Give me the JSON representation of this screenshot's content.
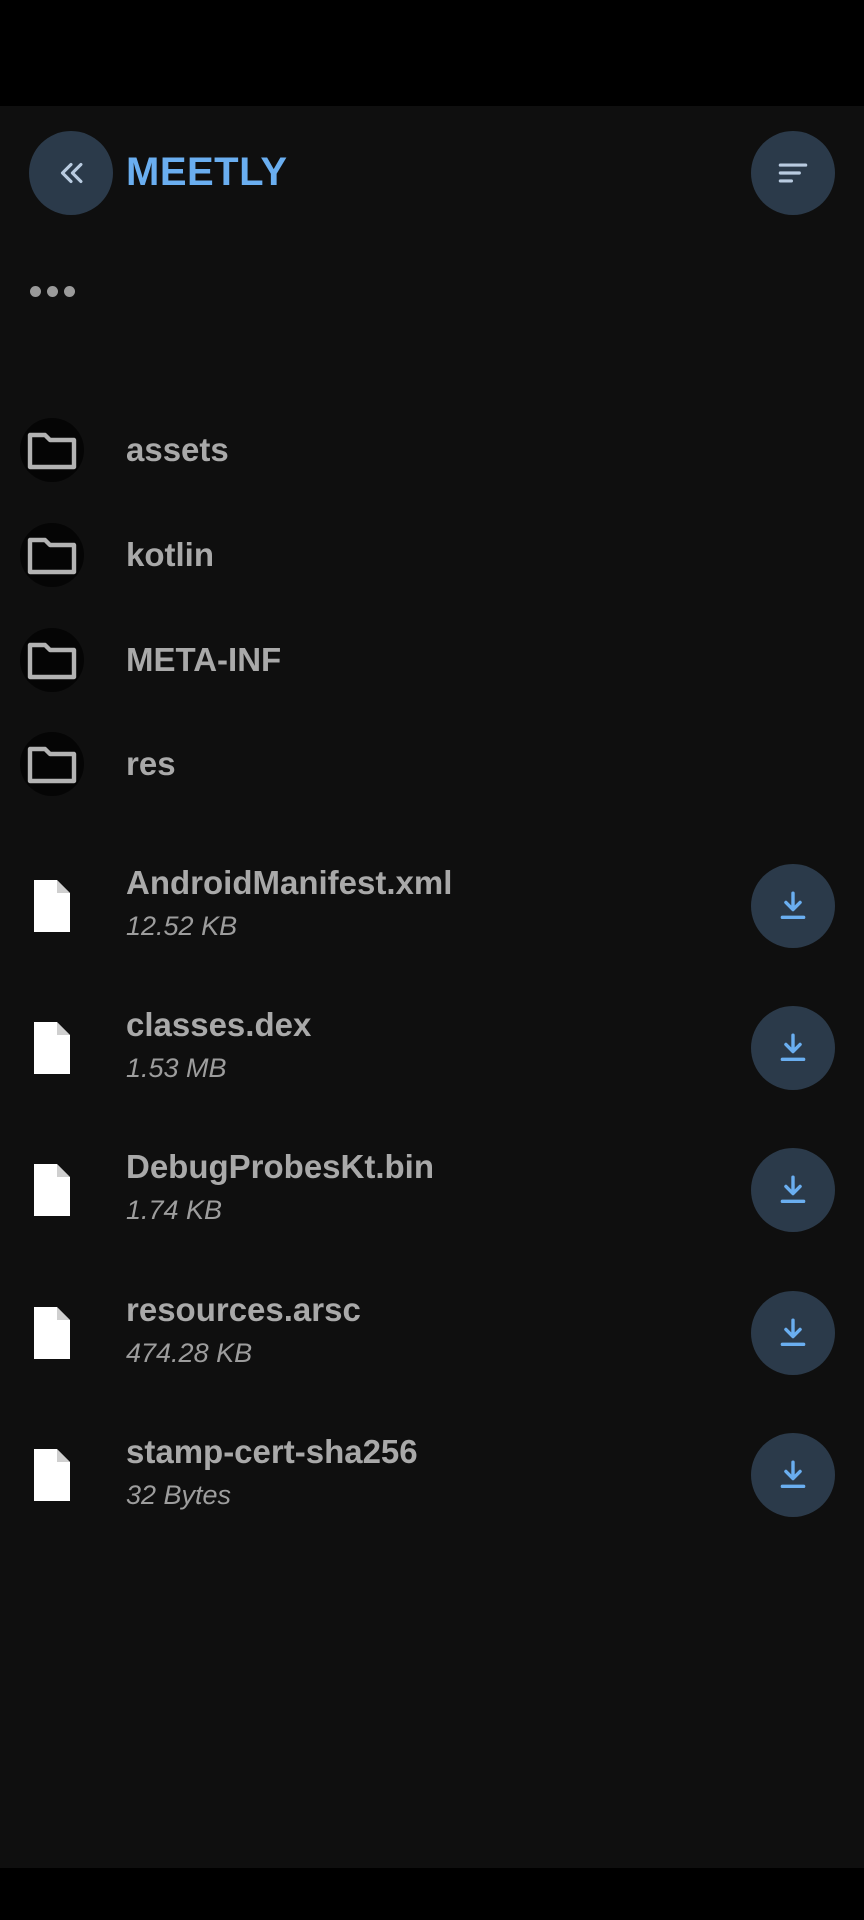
{
  "header": {
    "title": "MEETLY",
    "back_icon": "double-chevron-left-icon",
    "sort_icon": "sort-lines-icon"
  },
  "parent": {
    "icon": "more-horizontal-icon"
  },
  "colors": {
    "background": "#0f0f0f",
    "accent": "#6aaef0",
    "button_bg": "#2b3a4a",
    "text": "#a9a9a9"
  },
  "folders": [
    {
      "name": "assets"
    },
    {
      "name": "kotlin"
    },
    {
      "name": "META-INF"
    },
    {
      "name": "res"
    }
  ],
  "files": [
    {
      "name": "AndroidManifest.xml",
      "size": "12.52 KB"
    },
    {
      "name": "classes.dex",
      "size": "1.53 MB"
    },
    {
      "name": "DebugProbesKt.bin",
      "size": "1.74 KB"
    },
    {
      "name": "resources.arsc",
      "size": "474.28 KB"
    },
    {
      "name": "stamp-cert-sha256",
      "size": "32 Bytes"
    }
  ]
}
